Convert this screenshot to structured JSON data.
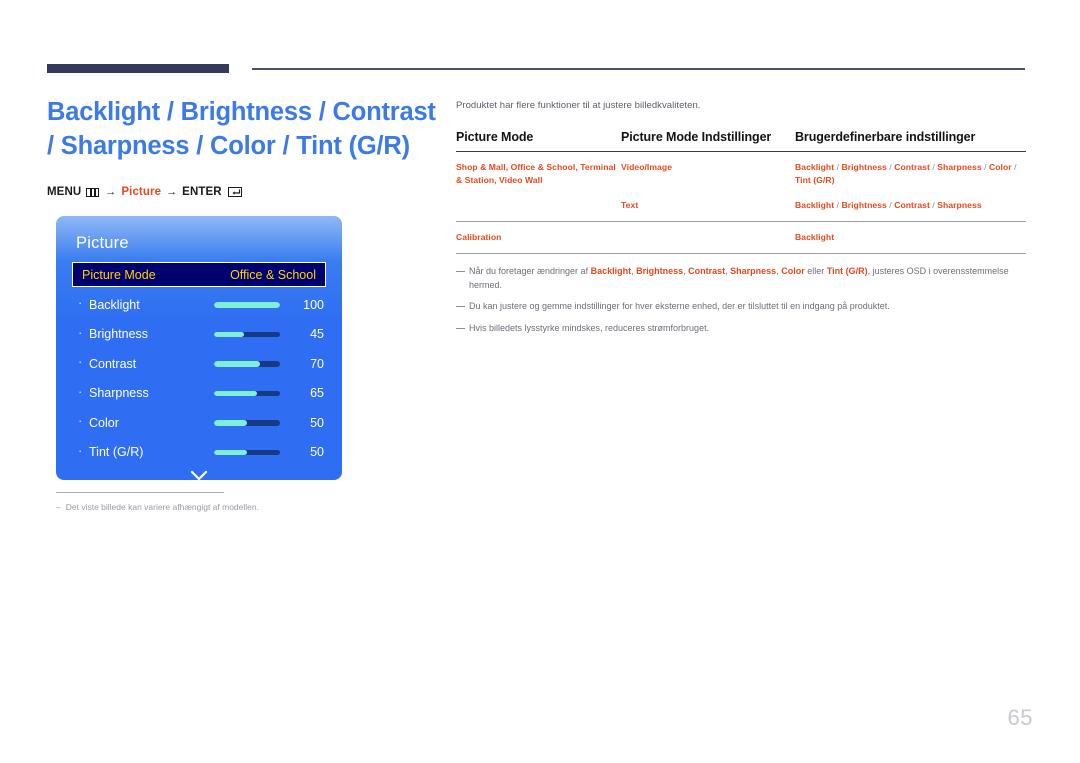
{
  "page_title": "Backlight / Brightness / Contrast / Sharpness / Color / Tint (G/R)",
  "menu_path": {
    "menu_label": "MENU",
    "menu_icon": "menu-grid-icon",
    "arrow": "→",
    "highlight": "Picture",
    "enter_label": "ENTER",
    "enter_icon": "enter-key-icon"
  },
  "osd": {
    "title": "Picture",
    "selected_row": {
      "label": "Picture Mode",
      "value": "Office & School"
    },
    "rows": [
      {
        "label": "Backlight",
        "value": "100",
        "percent": 100
      },
      {
        "label": "Brightness",
        "value": "45",
        "percent": 45
      },
      {
        "label": "Contrast",
        "value": "70",
        "percent": 70
      },
      {
        "label": "Sharpness",
        "value": "65",
        "percent": 65
      },
      {
        "label": "Color",
        "value": "50",
        "percent": 50
      },
      {
        "label": "Tint (G/R)",
        "value": "50",
        "percent": 50
      }
    ],
    "scroll_icon": "chevron-down-icon",
    "colors": {
      "panel_blue": "#2f6ef2",
      "selected_bg": "#00006e",
      "selected_text": "#ffd400",
      "slider_fill": "#7ef0d8",
      "slider_track": "#173a86"
    }
  },
  "left_note": {
    "dash": "–",
    "text": "Det viste billede kan variere afhængigt af modellen."
  },
  "right": {
    "intro": "Produktet har flere funktioner til at justere billedkvaliteten.",
    "table": {
      "headers": [
        "Picture Mode",
        "Picture Mode Indstillinger",
        "Brugerdefinerbare indstillinger"
      ],
      "rows": [
        {
          "col1": "Shop & Mall, Office & School, Terminal & Station, Video Wall",
          "col2": "Video/Image",
          "col3_parts": [
            "Backlight",
            "/",
            "Brightness",
            "/",
            "Contrast",
            "/",
            "Sharpness",
            "/",
            "Color",
            "/",
            "Tint (G/R)"
          ]
        },
        {
          "col1": "",
          "col2": "Text",
          "col3_parts": [
            "Backlight",
            "/",
            "Brightness",
            "/",
            "Contrast",
            "/",
            "Sharpness"
          ]
        },
        {
          "col1": "Calibration",
          "col2": "",
          "col3_parts": [
            "Backlight"
          ]
        }
      ]
    },
    "notes": [
      {
        "segments": [
          {
            "t": "Når du foretager ændringer af ",
            "b": false
          },
          {
            "t": "Backlight",
            "b": true
          },
          {
            "t": ", ",
            "b": false
          },
          {
            "t": "Brightness",
            "b": true
          },
          {
            "t": ", ",
            "b": false
          },
          {
            "t": "Contrast",
            "b": true
          },
          {
            "t": ", ",
            "b": false
          },
          {
            "t": "Sharpness",
            "b": true
          },
          {
            "t": ", ",
            "b": false
          },
          {
            "t": "Color",
            "b": true
          },
          {
            "t": " eller ",
            "b": false
          },
          {
            "t": "Tint (G/R)",
            "b": true
          },
          {
            "t": ", justeres OSD i overensstemmelse hermed.",
            "b": false
          }
        ]
      },
      {
        "segments": [
          {
            "t": "Du kan justere og gemme indstillinger for hver eksterne enhed, der er tilsluttet til en indgang på produktet.",
            "b": false
          }
        ]
      },
      {
        "segments": [
          {
            "t": "Hvis billedets lysstyrke mindskes, reduceres strømforbruget.",
            "b": false
          }
        ]
      }
    ]
  },
  "page_number": "65"
}
